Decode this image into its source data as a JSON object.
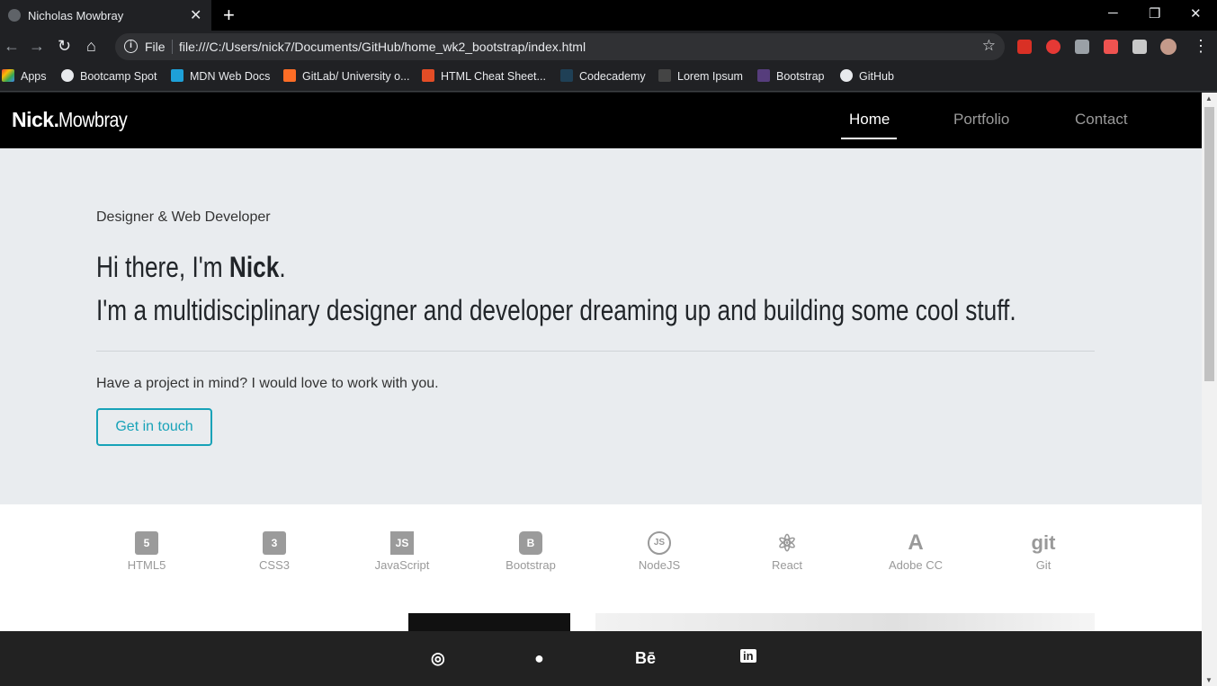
{
  "browser": {
    "tab_title": "Nicholas Mowbray",
    "tab_close": "✕",
    "new_tab": "+",
    "url_scheme": "File",
    "url": "file:///C:/Users/nick7/Documents/GitHub/home_wk2_bootstrap/index.html",
    "bookmarks": [
      "Apps",
      "Bootcamp Spot",
      "MDN Web Docs",
      "GitLab/ University o...",
      "HTML Cheat Sheet...",
      "Codecademy",
      "Lorem Ipsum",
      "Bootstrap",
      "GitHub"
    ]
  },
  "nav": {
    "brand_bold": "Nick.",
    "brand_rest": "Mowbray",
    "links": [
      "Home",
      "Portfolio",
      "Contact"
    ],
    "active": "Home"
  },
  "hero": {
    "kicker": "Designer & Web Developer",
    "line1_pre": "Hi there, I'm ",
    "line1_name": "Nick",
    "line1_post": ".",
    "line2": "I'm a multidisciplinary designer and developer dreaming up and building some cool stuff.",
    "cta_text": "Have a project in mind? I would love to work with you.",
    "cta_button": "Get in touch"
  },
  "skills": [
    {
      "label": "HTML5",
      "icon": "html5-icon",
      "glyph": "5"
    },
    {
      "label": "CSS3",
      "icon": "css3-icon",
      "glyph": "3"
    },
    {
      "label": "JavaScript",
      "icon": "javascript-icon",
      "glyph": "JS"
    },
    {
      "label": "Bootstrap",
      "icon": "bootstrap-icon",
      "glyph": "B"
    },
    {
      "label": "NodeJS",
      "icon": "nodejs-icon",
      "glyph": "JS"
    },
    {
      "label": "React",
      "icon": "react-icon",
      "glyph": "⚛"
    },
    {
      "label": "Adobe CC",
      "icon": "adobe-icon",
      "glyph": "A"
    },
    {
      "label": "Git",
      "icon": "git-icon",
      "glyph": "git"
    }
  ],
  "footer": {
    "social": [
      {
        "name": "instagram-icon",
        "glyph": "◎"
      },
      {
        "name": "github-icon",
        "glyph": "●"
      },
      {
        "name": "behance-icon",
        "glyph": "Bē"
      },
      {
        "name": "linkedin-icon",
        "glyph": "in"
      }
    ]
  },
  "colors": {
    "accent": "#17a2b8",
    "hero_bg": "#e9ecef",
    "navbar_bg": "#000000",
    "footer_bg": "#222222"
  }
}
